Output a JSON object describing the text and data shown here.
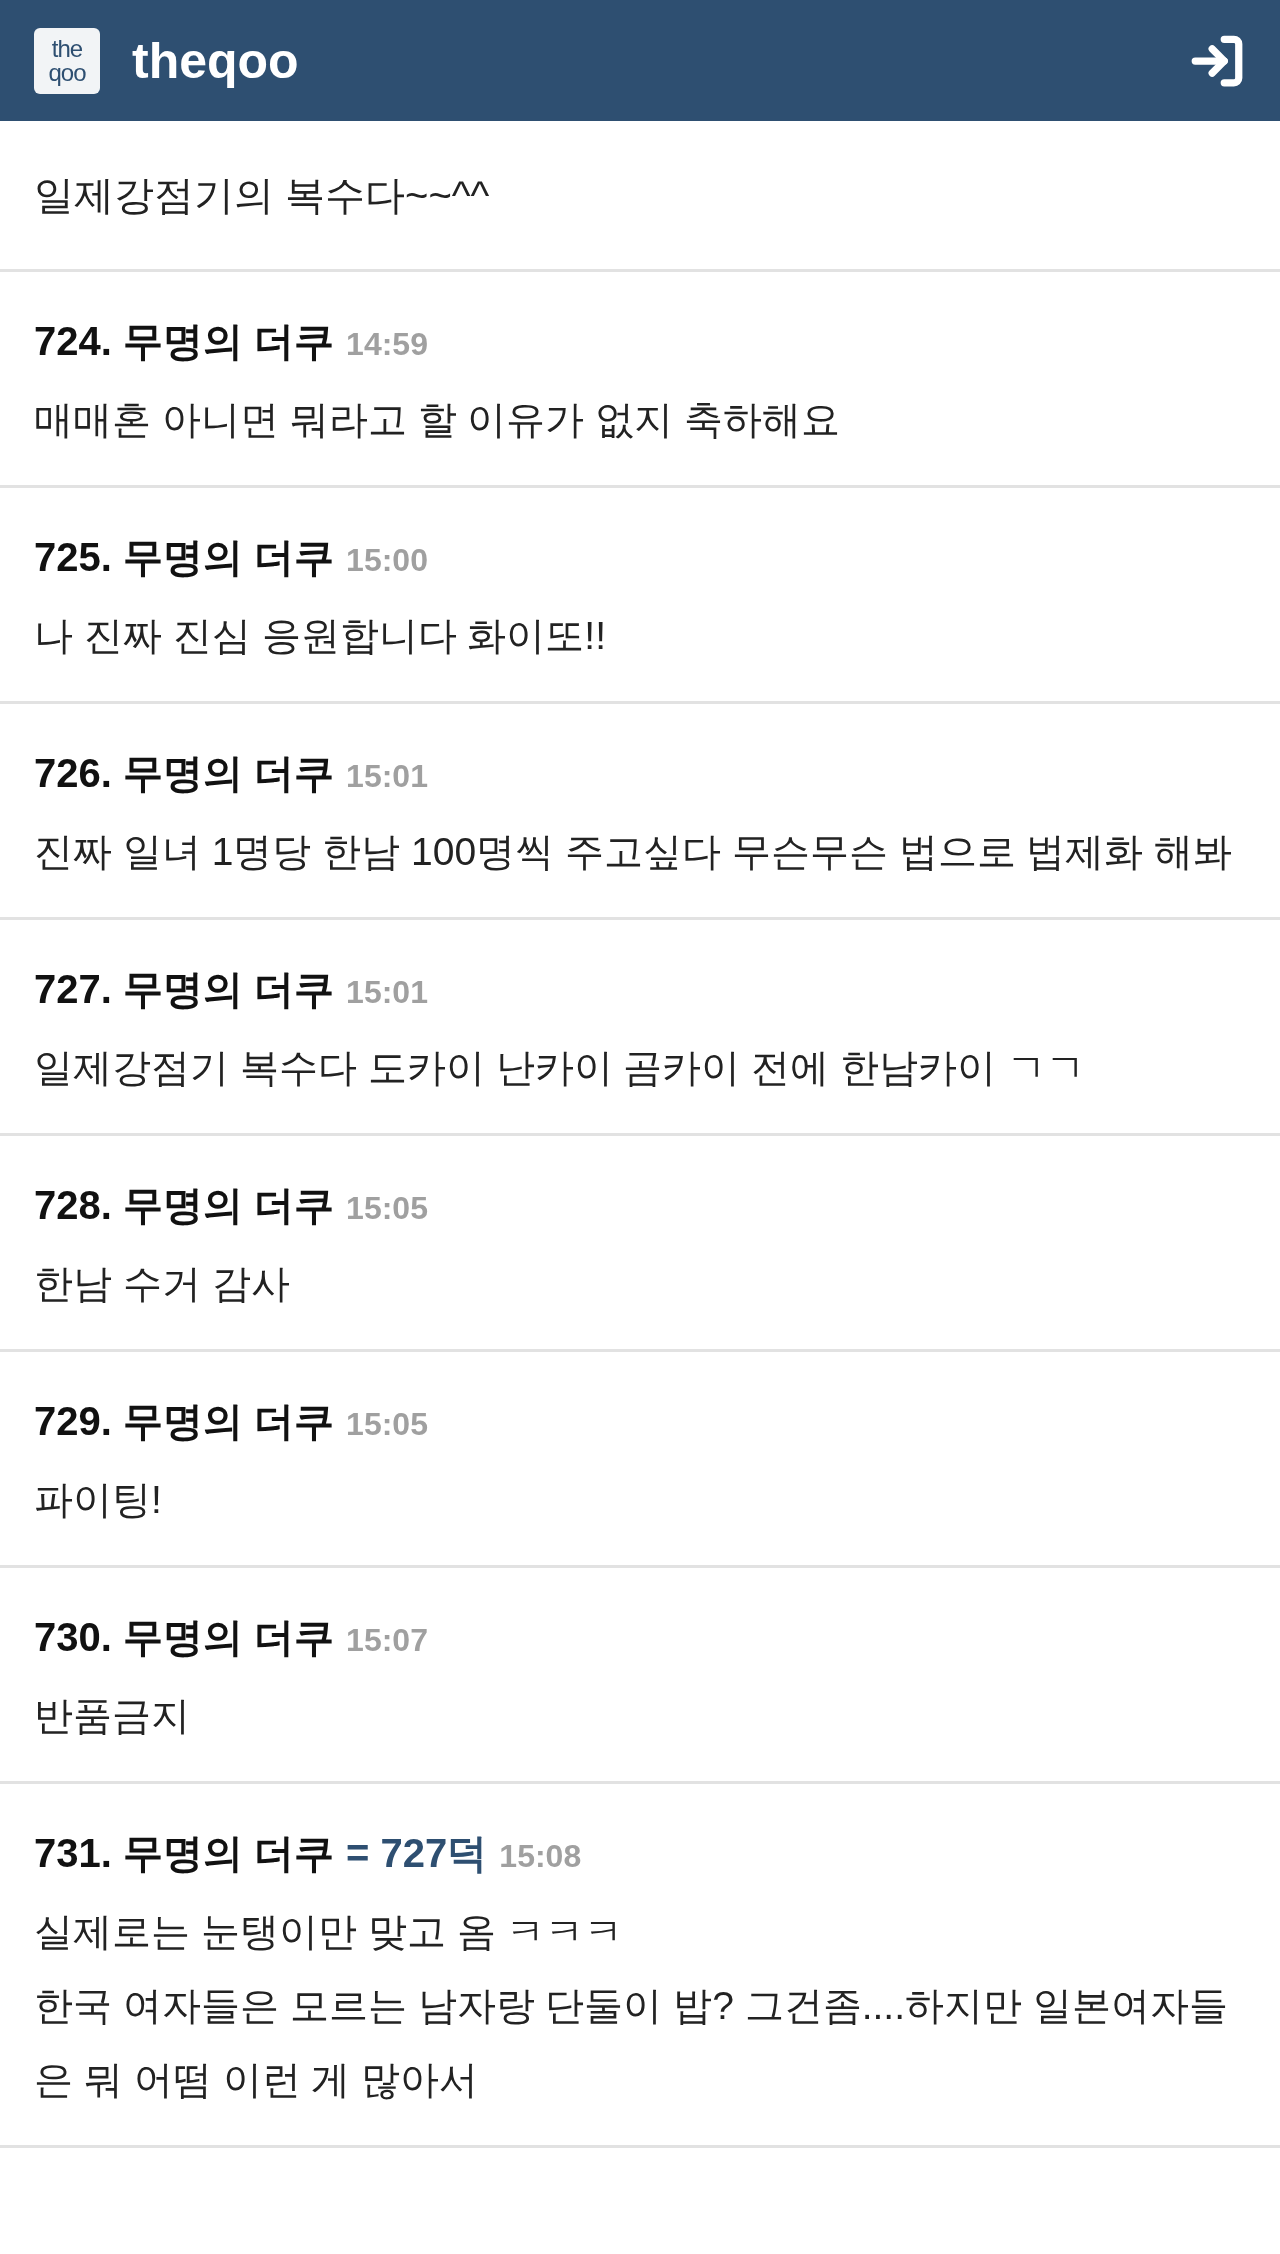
{
  "header": {
    "logo_text": [
      "the",
      "qoo"
    ],
    "title": "theqoo"
  },
  "intro": "일제강점기의 복수다~~^^",
  "comments": [
    {
      "number": "724.",
      "author": "무명의 더쿠",
      "time": "14:59",
      "body": "매매혼 아니면 뭐라고 할 이유가 없지 축하해요"
    },
    {
      "number": "725.",
      "author": "무명의 더쿠",
      "time": "15:00",
      "body": "나 진짜 진심 응원합니다 화이또!!"
    },
    {
      "number": "726.",
      "author": "무명의 더쿠",
      "time": "15:01",
      "body": "진짜 일녀 1명당 한남 100명씩 주고싶다 무슨무슨 법으로 법제화 해봐"
    },
    {
      "number": "727.",
      "author": "무명의 더쿠",
      "time": "15:01",
      "body": "일제강점기 복수다 도카이 난카이 곰카이 전에 한남카이 ㄱㄱ"
    },
    {
      "number": "728.",
      "author": "무명의 더쿠",
      "time": "15:05",
      "body": "한남 수거 감사"
    },
    {
      "number": "729.",
      "author": "무명의 더쿠",
      "time": "15:05",
      "body": "파이팅!"
    },
    {
      "number": "730.",
      "author": "무명의 더쿠",
      "time": "15:07",
      "body": "반품금지"
    },
    {
      "number": "731.",
      "author": "무명의 더쿠",
      "reply_to": "= 727덕",
      "time": "15:08",
      "body": "실제로는 눈탱이만 맞고 옴 ㅋㅋㅋ\n한국 여자들은 모르는 남자랑 단둘이 밥? 그건좀....하지만 일본여자들은 뭐 어떰 이런 게 많아서"
    }
  ]
}
